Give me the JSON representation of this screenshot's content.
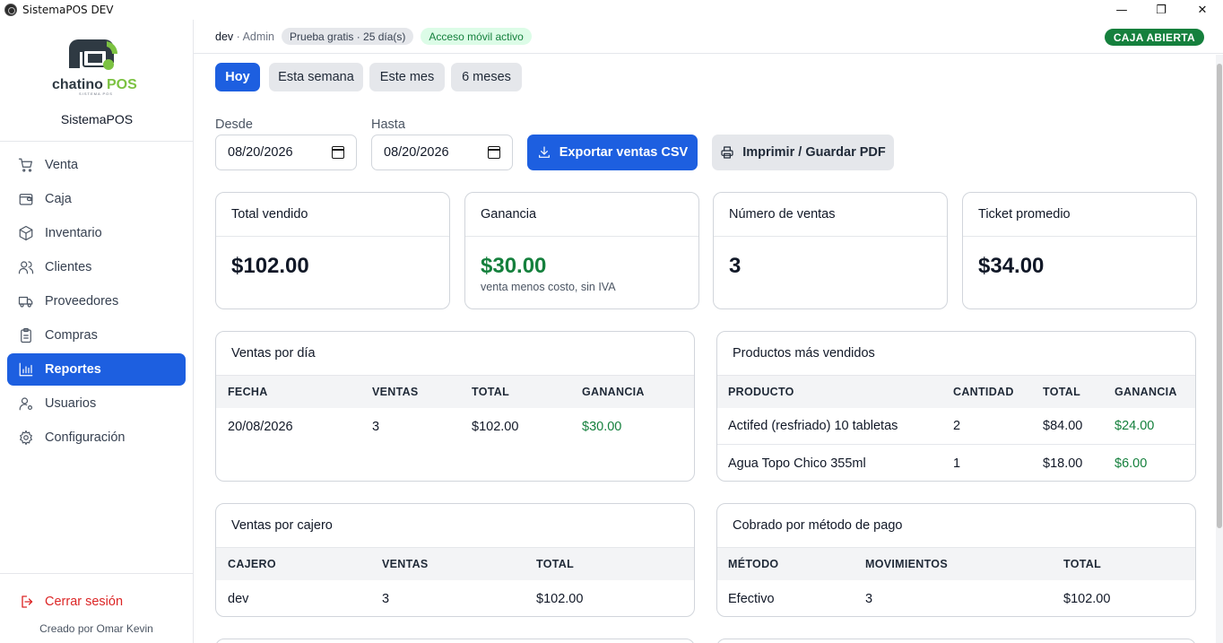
{
  "window": {
    "title": "SistemaPOS DEV",
    "minimize_glyph": "—",
    "maximize_glyph": "❐",
    "close_glyph": "✕"
  },
  "brand": {
    "logo_text_dark": "chatino",
    "logo_text_accent": "POS",
    "logo_tagline": "SISTEMA POS",
    "name": "SistemaPOS"
  },
  "sidebar": {
    "items": [
      {
        "label": "Venta",
        "icon": "cart-icon"
      },
      {
        "label": "Caja",
        "icon": "wallet-icon"
      },
      {
        "label": "Inventario",
        "icon": "box-icon"
      },
      {
        "label": "Clientes",
        "icon": "users-icon"
      },
      {
        "label": "Proveedores",
        "icon": "truck-icon"
      },
      {
        "label": "Compras",
        "icon": "clipboard-icon"
      },
      {
        "label": "Reportes",
        "icon": "bar-chart-icon",
        "active": true
      },
      {
        "label": "Usuarios",
        "icon": "user-gear-icon"
      },
      {
        "label": "Configuración",
        "icon": "gear-icon"
      }
    ],
    "logout_label": "Cerrar sesión",
    "credit": "Creado por Omar Kevin"
  },
  "header": {
    "user": "dev",
    "separator": " · ",
    "role": "Admin",
    "trial_badge": "Prueba gratis · 25 día(s)",
    "mobile_badge": "Acceso móvil activo",
    "register_status": "CAJA ABIERTA"
  },
  "colors": {
    "accent": "#1d5fe0",
    "success": "#15803d",
    "danger": "#dc2626",
    "logo_green": "#7cc242"
  },
  "filters": {
    "ranges": [
      "Hoy",
      "Esta semana",
      "Este mes",
      "6 meses"
    ],
    "active_range": "Hoy",
    "from_label": "Desde",
    "from_value": "08/20/2026",
    "to_label": "Hasta",
    "to_value": "08/20/2026",
    "export_label": "Exportar ventas CSV",
    "print_label": "Imprimir / Guardar PDF"
  },
  "stats": [
    {
      "label": "Total vendido",
      "value": "$102.00",
      "sub": ""
    },
    {
      "label": "Ganancia",
      "value": "$30.00",
      "sub": "venta menos costo, sin IVA"
    },
    {
      "label": "Número de ventas",
      "value": "3",
      "sub": ""
    },
    {
      "label": "Ticket promedio",
      "value": "$34.00",
      "sub": ""
    }
  ],
  "ventas_por_dia": {
    "title": "Ventas por día",
    "columns": [
      "FECHA",
      "VENTAS",
      "TOTAL",
      "GANANCIA"
    ],
    "rows": [
      [
        "20/08/2026",
        "3",
        "$102.00",
        "$30.00"
      ]
    ]
  },
  "productos": {
    "title": "Productos más vendidos",
    "columns": [
      "PRODUCTO",
      "CANTIDAD",
      "TOTAL",
      "GANANCIA"
    ],
    "rows": [
      [
        "Actifed (resfriado) 10 tabletas",
        "2",
        "$84.00",
        "$24.00"
      ],
      [
        "Agua Topo Chico 355ml",
        "1",
        "$18.00",
        "$6.00"
      ]
    ]
  },
  "ventas_por_cajero": {
    "title": "Ventas por cajero",
    "columns": [
      "CAJERO",
      "VENTAS",
      "TOTAL"
    ],
    "rows": [
      [
        "dev",
        "3",
        "$102.00"
      ]
    ]
  },
  "metodo_pago": {
    "title": "Cobrado por método de pago",
    "columns": [
      "MÉTODO",
      "MOVIMIENTOS",
      "TOTAL"
    ],
    "rows": [
      [
        "Efectivo",
        "3",
        "$102.00"
      ]
    ]
  }
}
